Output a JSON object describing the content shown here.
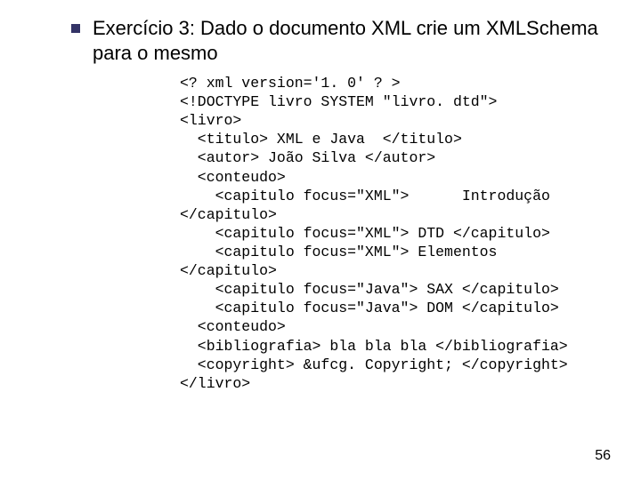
{
  "title": "Exercício 3: Dado o documento XML crie um XMLSchema para o mesmo",
  "code": "<? xml version='1. 0' ? >\n<!DOCTYPE livro SYSTEM \"livro. dtd\">\n<livro>\n  <titulo> XML e Java  </titulo>\n  <autor> João Silva </autor>\n  <conteudo>\n    <capitulo focus=\"XML\">      Introdução\n</capitulo>\n    <capitulo focus=\"XML\"> DTD </capitulo>\n    <capitulo focus=\"XML\"> Elementos\n</capitulo>\n    <capitulo focus=\"Java\"> SAX </capitulo>\n    <capitulo focus=\"Java\"> DOM </capitulo>\n  <conteudo>\n  <bibliografia> bla bla bla </bibliografia>\n  <copyright> &ufcg. Copyright; </copyright>\n</livro>",
  "page_number": "56"
}
